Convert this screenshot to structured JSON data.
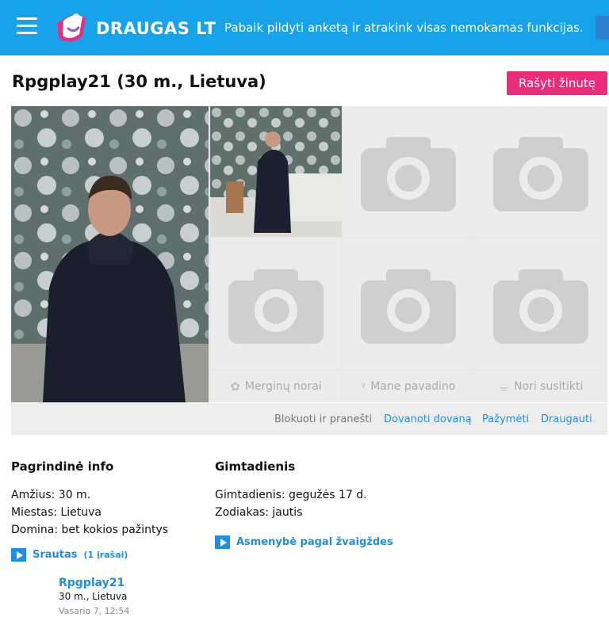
{
  "header": {
    "logo_text": "DRAUGAS LT",
    "promo": "Pabaik pildyti anketą ir atrakink visas nemokamas funkcijas."
  },
  "profile": {
    "title": "Rpgplay21 (30 m., Lietuva)",
    "write_button": "Rašyti žinutę"
  },
  "actions": {
    "tiles": [
      "Merginų norai",
      "Mane pavadino",
      "Nori susitikti"
    ],
    "block": "Blokuoti ir pranešti",
    "links": [
      "Dovanoti dovaną",
      "Pažymėti",
      "Draugauti"
    ]
  },
  "basic_info": {
    "title": "Pagrindinė info",
    "lines": [
      "Amžius: 30 m.",
      "Miestas: Lietuva",
      "Domina: bet kokios pažintys"
    ]
  },
  "birthday": {
    "title": "Gimtadienis",
    "lines": [
      "Gimtadienis: gegužės 17 d.",
      "Zodiakas: jautis"
    ],
    "link": "Asmenybė pagal žvaigždes"
  },
  "feed": {
    "label": "Srautas",
    "count": "(1 įrašai)",
    "post": {
      "name": "Rpgplay21",
      "sub": "30 m., Lietuva",
      "date": "Vasario 7, 12:54"
    }
  },
  "colors": {
    "header_bg": "#16a3ea",
    "accent_pink": "#ec2c7b",
    "link_blue": "#1d8fe0"
  }
}
